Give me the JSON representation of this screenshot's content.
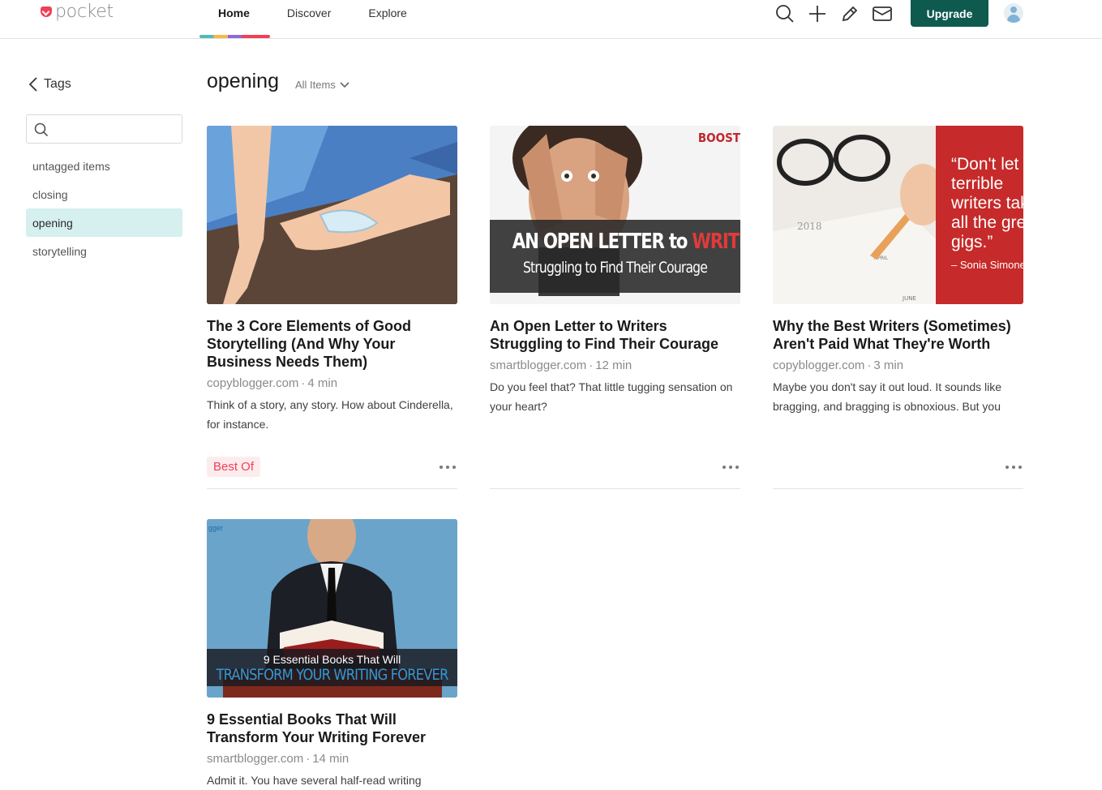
{
  "app": {
    "logo_text": "pocket",
    "nav": [
      {
        "label": "Home",
        "active": true
      },
      {
        "label": "Discover",
        "active": false
      },
      {
        "label": "Explore",
        "active": false
      }
    ],
    "upgrade_label": "Upgrade",
    "colors": {
      "brand_red": "#ef4056",
      "upgrade_bg": "#0f5a4f",
      "active_tag_bg": "#d5f0ee"
    }
  },
  "sidebar": {
    "back_label": "Tags",
    "search_placeholder": "",
    "tags": [
      {
        "label": "untagged items",
        "active": false
      },
      {
        "label": "closing",
        "active": false
      },
      {
        "label": "opening",
        "active": true
      },
      {
        "label": "storytelling",
        "active": false
      }
    ]
  },
  "main": {
    "title": "opening",
    "filter_label": "All Items",
    "cards": [
      {
        "title": "The 3 Core Elements of Good Storytelling (And Why Your Business Needs Them)",
        "domain": "copyblogger.com",
        "read_time": "4 min",
        "excerpt": "Think of a story, any story. How about Cinderella, for instance.",
        "tag": "Best Of"
      },
      {
        "title": "An Open Letter to Writers Struggling to Find Their Courage",
        "domain": "smartblogger.com",
        "read_time": "12 min",
        "excerpt": "Do you feel that? That little tugging sensation on your heart?",
        "image_text": {
          "corner": "BOOST",
          "line1a": "AN OPEN LETTER to ",
          "line1b": "WRITERS",
          "line2": "Struggling to Find Their Courage"
        }
      },
      {
        "title": "Why the Best Writers (Sometimes) Aren't Paid What They're Worth",
        "domain": "copyblogger.com",
        "read_time": "3 min",
        "excerpt": "Maybe you don't say it out loud. It sounds like bragging, and bragging is obnoxious. But you",
        "image_text": {
          "quote": "“Don't let terrible writers take all the great gigs.”",
          "attribution": "– Sonia Simone",
          "year": "2018",
          "month1": "APRIL",
          "month2": "JUNE"
        }
      },
      {
        "title": "9 Essential Books That Will Transform Your Writing Forever",
        "domain": "smartblogger.com",
        "read_time": "14 min",
        "excerpt": "Admit it. You have several half-read writing",
        "image_text": {
          "corner": "gger",
          "line1": "9 Essential Books That Will",
          "line2": "TRANSFORM YOUR WRITING FOREVER"
        }
      }
    ]
  }
}
